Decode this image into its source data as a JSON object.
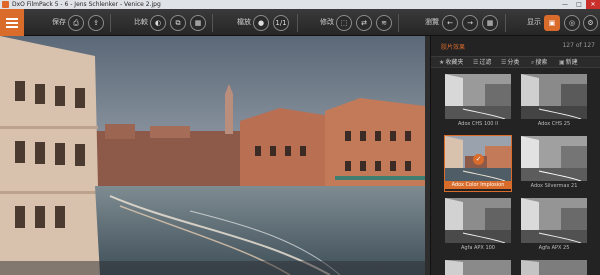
{
  "window": {
    "title": "DxO FilmPack 5 - 6 - Jens Schlenker - Venice 2.jpg",
    "minimize": "—",
    "maximize": "□",
    "close": "✕"
  },
  "toolbar": {
    "save_label": "保存",
    "compare_label": "比較",
    "zoom_label": "檔放",
    "zoom_fit": "1/1",
    "edit_label": "修改",
    "browse_label": "瀏覽",
    "display_label": "显示"
  },
  "panel": {
    "title": "胶片效果",
    "count": "127 of 127",
    "filters": [
      {
        "icon": "★",
        "label": "收藏夹"
      },
      {
        "icon": "☰",
        "label": "过滤"
      },
      {
        "icon": "☰",
        "label": "分类"
      },
      {
        "icon": "⌕",
        "label": "搜索"
      },
      {
        "icon": "▣",
        "label": "新建"
      }
    ],
    "thumbnails": [
      {
        "caption": "Adox CHS 100 II",
        "selected": false,
        "tone": "bw"
      },
      {
        "caption": "Adox CHS 25",
        "selected": false,
        "tone": "bw"
      },
      {
        "caption": "Adox Color Implosion",
        "selected": true,
        "tone": "color"
      },
      {
        "caption": "Adox Silvermax 21",
        "selected": false,
        "tone": "bw"
      },
      {
        "caption": "Agfa APX 100",
        "selected": false,
        "tone": "bw"
      },
      {
        "caption": "Agfa APX 25",
        "selected": false,
        "tone": "bw"
      }
    ]
  },
  "colors": {
    "accent": "#d96b2b",
    "panel": "#232323",
    "toolbar": "#2e2e2e"
  },
  "icons": {
    "menu": "menu-icon",
    "check": "✓"
  }
}
